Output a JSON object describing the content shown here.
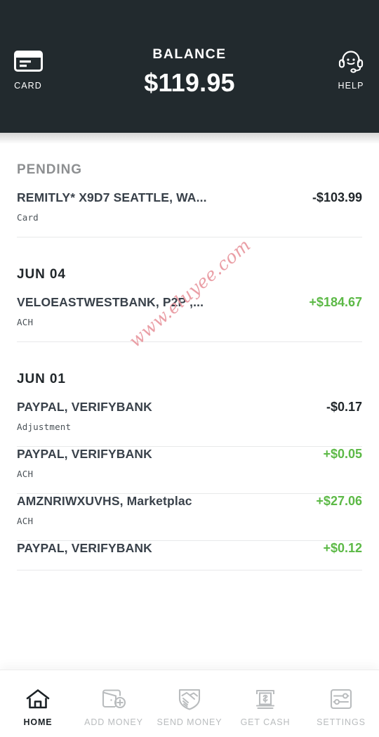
{
  "header": {
    "balance_label": "BALANCE",
    "balance_amount": "$119.95",
    "left_action": {
      "label": "CARD",
      "icon": "credit-card-icon"
    },
    "right_action": {
      "label": "HELP",
      "icon": "headset-support-icon"
    },
    "background_color": "#222a2e"
  },
  "colors": {
    "positive_amount": "#5cb946",
    "negative_amount": "#21272b",
    "watermark": "#e99aa2",
    "divider": "#e8e9ea",
    "nav_inactive": "#b9bcbe",
    "nav_active": "#1b2125"
  },
  "watermark": {
    "text": "www.eluyee.com"
  },
  "sections": [
    {
      "title": "PENDING",
      "muted": true,
      "transactions": [
        {
          "name": "REMITLY* X9D7 SEATTLE, WA...",
          "amount": "-$103.99",
          "positive": false,
          "method": "Card"
        }
      ]
    },
    {
      "title": "JUN 04",
      "muted": false,
      "transactions": [
        {
          "name": "VELOEASTWESTBANK, P2P ,...",
          "amount": "+$184.67",
          "positive": true,
          "method": "ACH"
        }
      ]
    },
    {
      "title": "JUN 01",
      "muted": false,
      "transactions": [
        {
          "name": "PAYPAL, VERIFYBANK",
          "amount": "-$0.17",
          "positive": false,
          "method": "Adjustment"
        },
        {
          "name": "PAYPAL, VERIFYBANK",
          "amount": "+$0.05",
          "positive": true,
          "method": "ACH"
        },
        {
          "name": "AMZNRIWXUVHS, Marketplac",
          "amount": "+$27.06",
          "positive": true,
          "method": "ACH"
        },
        {
          "name": "PAYPAL, VERIFYBANK",
          "amount": "+$0.12",
          "positive": true,
          "method": ""
        }
      ]
    }
  ],
  "bottom_nav": {
    "items": [
      {
        "label": "HOME",
        "icon": "home-icon",
        "active": true
      },
      {
        "label": "ADD MONEY",
        "icon": "wallet-plus-icon",
        "active": false
      },
      {
        "label": "SEND MONEY",
        "icon": "handshake-icon",
        "active": false
      },
      {
        "label": "GET CASH",
        "icon": "atm-cash-icon",
        "active": false
      },
      {
        "label": "SETTINGS",
        "icon": "sliders-icon",
        "active": false
      }
    ]
  }
}
